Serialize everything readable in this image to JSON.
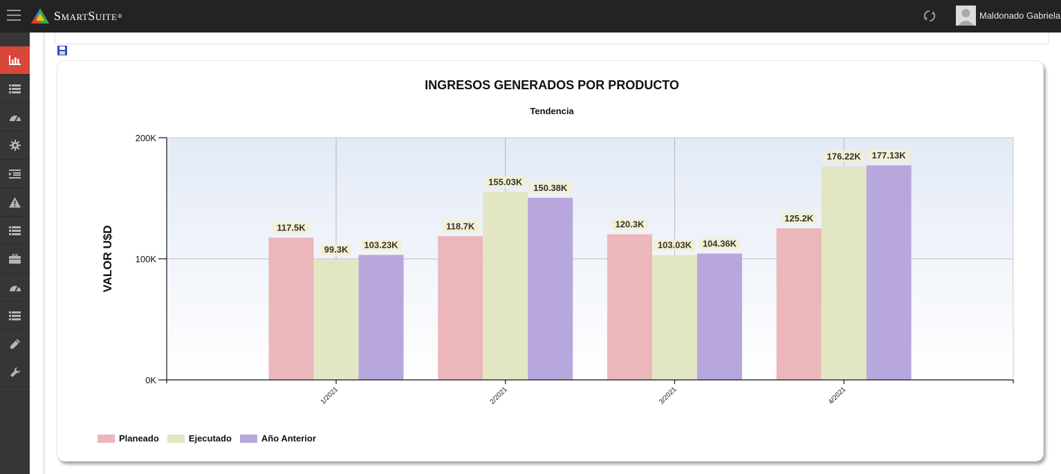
{
  "app": {
    "brand": "SmartSuite",
    "brand_mark": "®",
    "user_name": "Maldonado Gabriela"
  },
  "sidebar": {
    "items": [
      {
        "icon": "bar-chart-icon",
        "active": true
      },
      {
        "icon": "list-icon",
        "active": false
      },
      {
        "icon": "dashboard-icon",
        "active": false
      },
      {
        "icon": "gear-icon",
        "active": false
      },
      {
        "icon": "indent-list-icon",
        "active": false
      },
      {
        "icon": "warning-icon",
        "active": false
      },
      {
        "icon": "list-icon",
        "active": false
      },
      {
        "icon": "briefcase-icon",
        "active": false
      },
      {
        "icon": "dashboard-icon",
        "active": false
      },
      {
        "icon": "list-icon",
        "active": false
      },
      {
        "icon": "pencil-icon",
        "active": false
      },
      {
        "icon": "wrench-icon",
        "active": false
      }
    ]
  },
  "colors": {
    "topbar": "#232323",
    "sidebar": "#363636",
    "sidebar_active": "#d9463a"
  },
  "chart_data": {
    "type": "bar",
    "title": "INGRESOS GENERADOS POR PRODUCTO",
    "subtitle": "Tendencia",
    "xlabel": "",
    "ylabel": "VALOR U$D",
    "ylim": [
      0,
      200000
    ],
    "yticks": [
      0,
      100000,
      200000
    ],
    "ytick_labels": [
      "0K",
      "100K",
      "200K"
    ],
    "categories": [
      "1/2021",
      "2/2021",
      "3/2021",
      "4/2021"
    ],
    "grid": true,
    "legend_position": "bottom-left",
    "series": [
      {
        "name": "Planeado",
        "color": "#ebb7bb",
        "values": [
          117500,
          118700,
          120300,
          125200
        ],
        "labels": [
          "117.5K",
          "118.7K",
          "120.3K",
          "125.2K"
        ]
      },
      {
        "name": "Ejecutado",
        "color": "#e2e6c2",
        "values": [
          99300,
          155030,
          103030,
          176220
        ],
        "labels": [
          "99.3K",
          "155.03K",
          "103.03K",
          "176.22K"
        ]
      },
      {
        "name": "Año Anterior",
        "color": "#b8a7dc",
        "values": [
          103230,
          150380,
          104360,
          177130
        ],
        "labels": [
          "103.23K",
          "150.38K",
          "104.36K",
          "177.13K"
        ]
      }
    ]
  }
}
